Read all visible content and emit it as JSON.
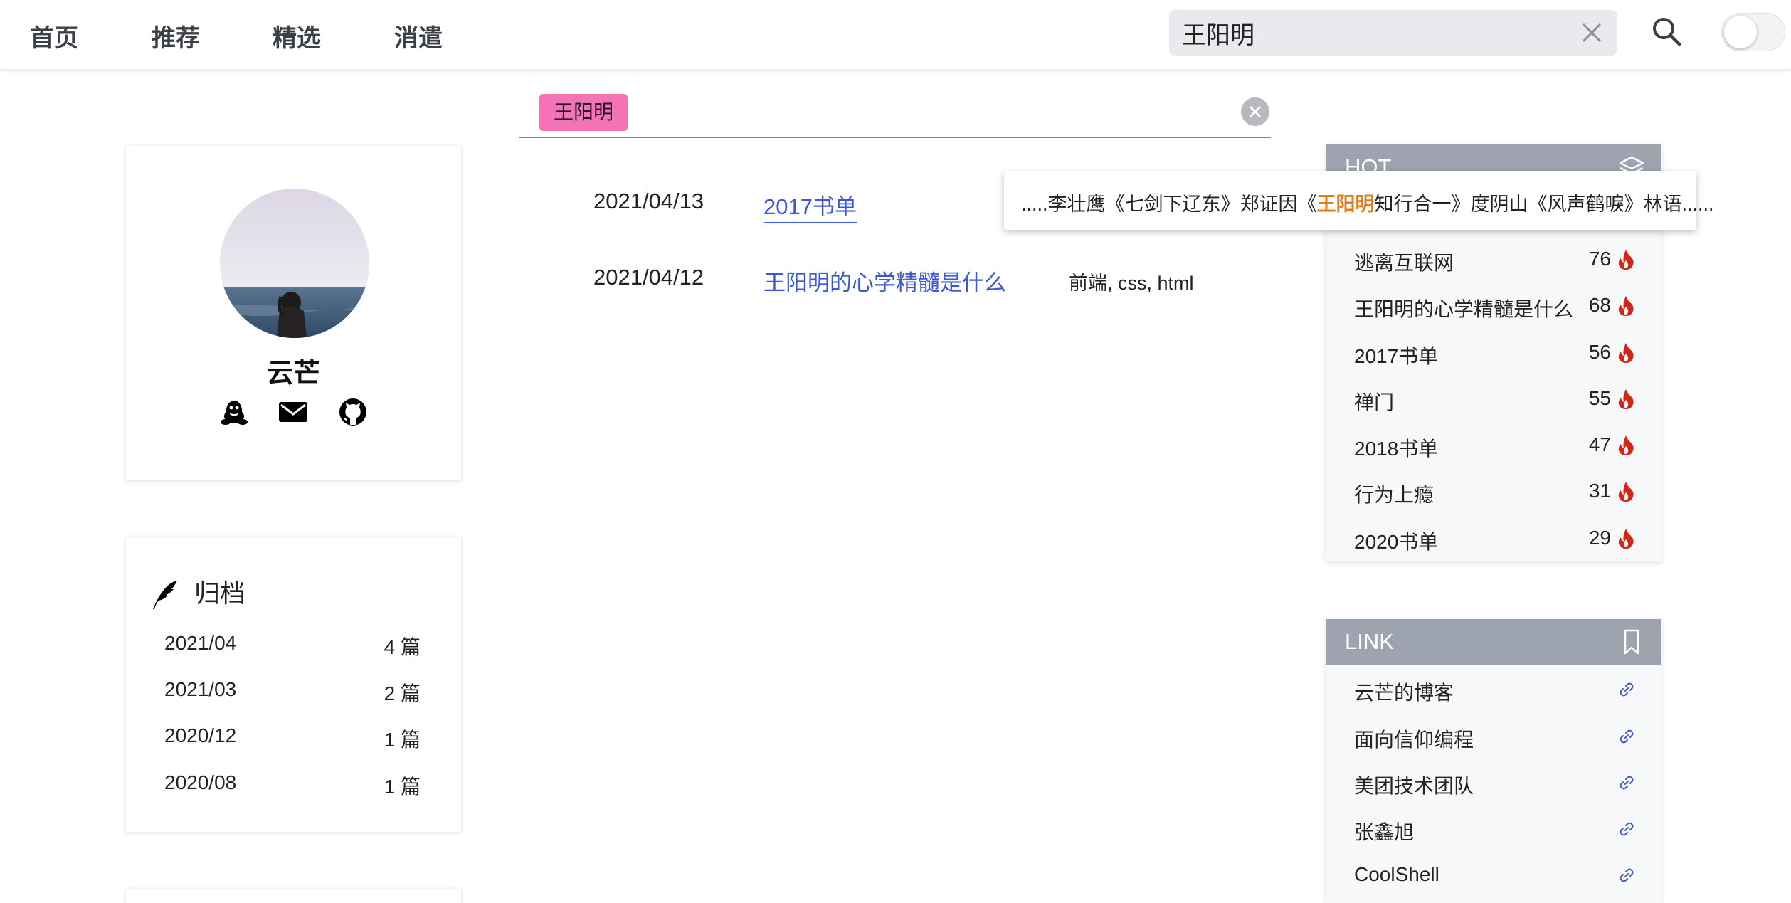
{
  "nav": {
    "items": [
      "首页",
      "推荐",
      "精选",
      "消遣"
    ],
    "search": {
      "value": "王阳明"
    }
  },
  "profile": {
    "name": "云芒"
  },
  "archive": {
    "title": "归档",
    "rows": [
      {
        "date": "2021/04",
        "count": "4 篇"
      },
      {
        "date": "2021/03",
        "count": "2 篇"
      },
      {
        "date": "2020/12",
        "count": "1 篇"
      },
      {
        "date": "2020/08",
        "count": "1 篇"
      }
    ]
  },
  "search_tag": "王阳明",
  "results": [
    {
      "date": "2021/04/13",
      "title": "2017书单",
      "tags": ""
    },
    {
      "date": "2021/04/12",
      "title": "王阳明的心学精髓是什么",
      "tags": "前端, css, html"
    }
  ],
  "tooltip": {
    "before": ".....李壮鹰《七剑下辽东》郑证因《",
    "highlight": "王阳明",
    "after": "知行合一》度阴山《风声鹤唳》林语......"
  },
  "hot": {
    "title": "HOT",
    "items": [
      {
        "name": "逃离互联网",
        "count": "76"
      },
      {
        "name": "王阳明的心学精髓是什么",
        "count": "68"
      },
      {
        "name": "2017书单",
        "count": "56"
      },
      {
        "name": "禅门",
        "count": "55"
      },
      {
        "name": "2018书单",
        "count": "47"
      },
      {
        "name": "行为上瘾",
        "count": "31"
      },
      {
        "name": "2020书单",
        "count": "29"
      }
    ]
  },
  "link": {
    "title": "LINK",
    "items": [
      "云芒的博客",
      "面向信仰编程",
      "美团技术团队",
      "张鑫旭",
      "CoolShell"
    ]
  },
  "colors": {
    "accent_link": "#3b57d9",
    "tag_bg": "#f472b6",
    "panel_head": "#9da3af",
    "fire": "#d0271a",
    "highlight": "#e07a1a"
  },
  "icons": {
    "search": "search-icon",
    "clear": "close-icon",
    "qq": "qq-penguin-icon",
    "mail": "mail-icon",
    "github": "github-icon",
    "archive": "feather-icon",
    "hot": "layers-icon",
    "link": "bookmark-icon",
    "fire": "fire-icon",
    "chain": "link-chain-icon"
  }
}
